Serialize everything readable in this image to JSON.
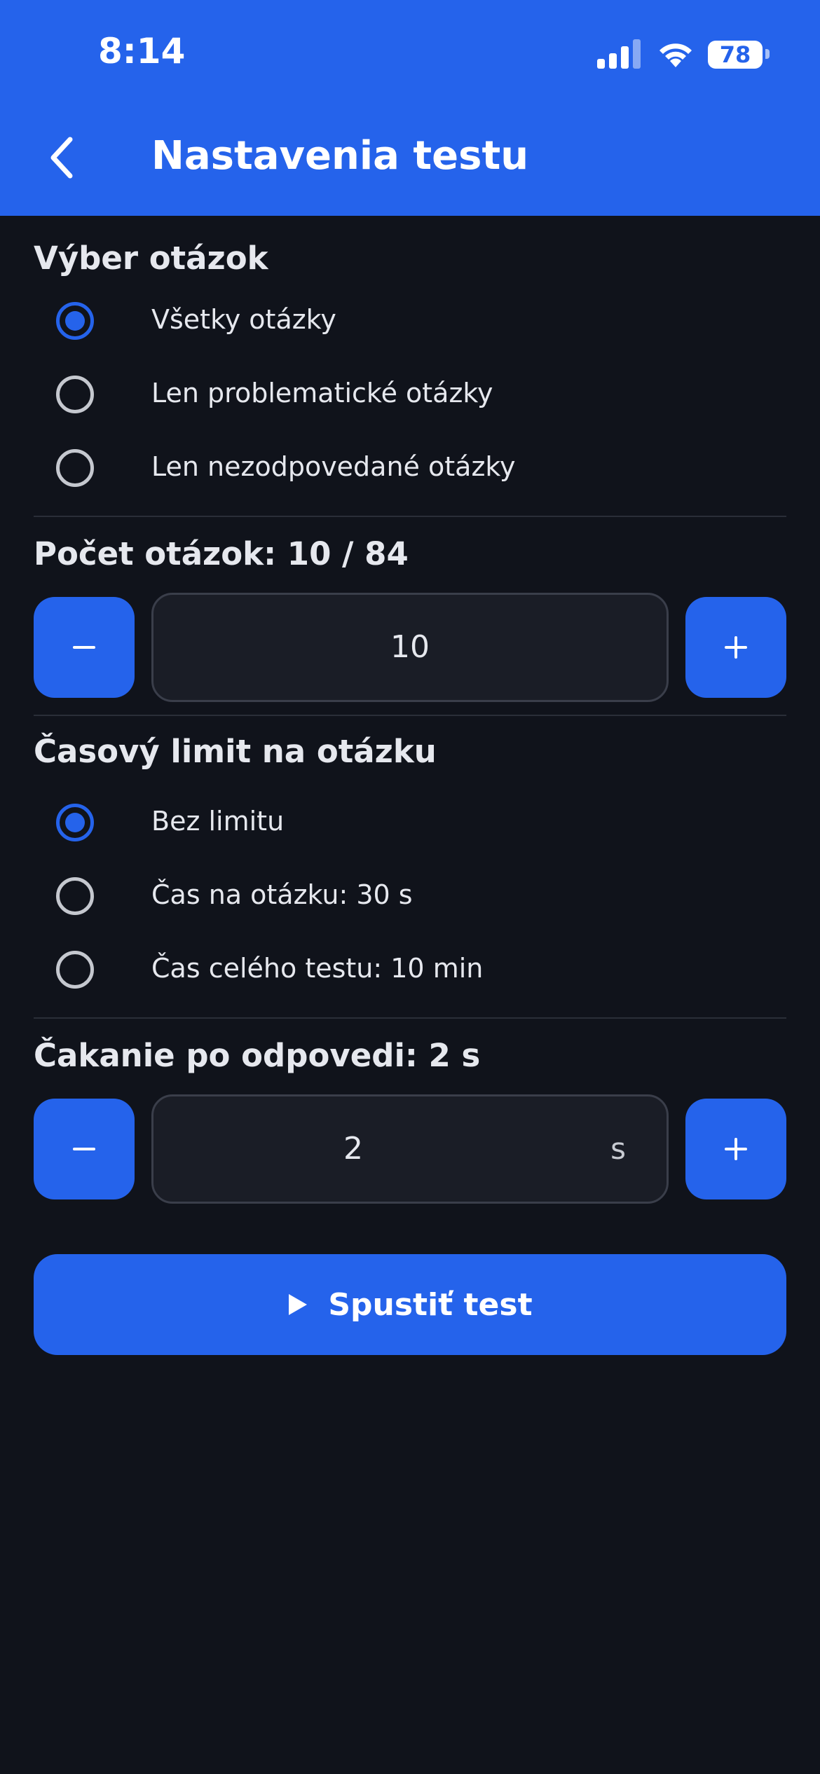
{
  "status_bar": {
    "time": "8:14",
    "battery_percent": "78",
    "battery_level": 0.78
  },
  "header": {
    "title": "Nastavenia testu"
  },
  "question_selection": {
    "title": "Výber otázok",
    "options": [
      {
        "label": "Všetky otázky",
        "selected": true
      },
      {
        "label": "Len problematické otázky",
        "selected": false
      },
      {
        "label": "Len nezodpovedané otázky",
        "selected": false
      }
    ]
  },
  "question_count": {
    "title": "Počet otázok: 10 / 84",
    "value": "10",
    "decrement_icon": "minus-icon",
    "increment_icon": "plus-icon"
  },
  "time_limit": {
    "title": "Časový limit na otázku",
    "options": [
      {
        "label": "Bez limitu",
        "selected": true
      },
      {
        "label": "Čas na otázku: 30 s",
        "selected": false
      },
      {
        "label": "Čas celého testu: 10 min",
        "selected": false
      }
    ]
  },
  "answer_delay": {
    "title": "Čakanie po odpovedi: 2 s",
    "value": "2",
    "unit": "s"
  },
  "start_button": {
    "label": "Spustiť test",
    "icon": "play-icon"
  },
  "colors": {
    "accent": "#2563eb",
    "background": "#10131b",
    "field": "#1a1d26"
  }
}
